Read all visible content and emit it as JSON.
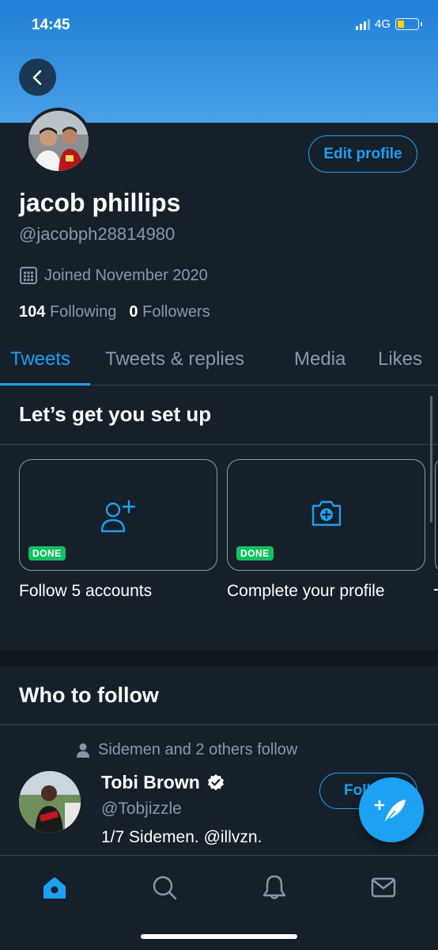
{
  "status_bar": {
    "time": "14:45",
    "network": "4G"
  },
  "profile": {
    "name": "jacob phillips",
    "handle": "@jacobph28814980",
    "joined": "Joined November 2020",
    "following_count": "104",
    "following_label": "Following",
    "followers_count": "0",
    "followers_label": "Followers",
    "edit_label": "Edit profile"
  },
  "tabs": [
    {
      "label": "Tweets",
      "active": true
    },
    {
      "label": "Tweets & replies"
    },
    {
      "label": "Media"
    },
    {
      "label": "Likes"
    }
  ],
  "setup": {
    "title": "Let’s get you set up",
    "cards": [
      {
        "label": "Follow 5 accounts",
        "badge": "DONE",
        "icon": "add-user-icon"
      },
      {
        "label": "Complete your profile",
        "badge": "DONE",
        "icon": "camera-plus-icon"
      }
    ]
  },
  "who_to_follow": {
    "title": "Who to follow",
    "social_context": "Sidemen and 2 others follow",
    "user": {
      "name": "Tobi Brown",
      "handle": "@Tobjizzle",
      "bio": "1/7 Sidemen. @illvzn.",
      "verified": true,
      "follow_label": "Follow"
    }
  },
  "colors": {
    "accent": "#1da1f2",
    "background": "#15202b",
    "secondary_text": "#8899a6",
    "done": "#17bf63"
  },
  "nav": [
    "home-icon",
    "search-icon",
    "bell-icon",
    "mail-icon"
  ]
}
